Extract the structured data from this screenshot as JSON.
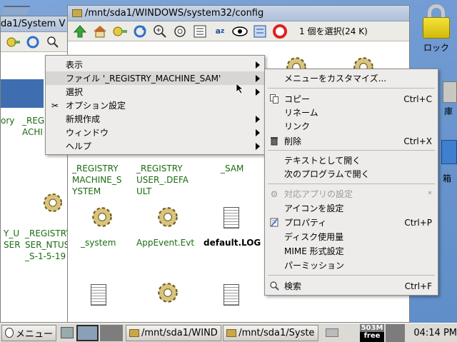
{
  "desktop": {
    "lock_label": "ロック",
    "right_labels": [
      "箱",
      "庫",
      "箱"
    ]
  },
  "back_window": {
    "title": "da1/System V",
    "left_labels": [
      "ory",
      "_REGI",
      "ACHI",
      "Y_U",
      "SER",
      "_REGISTRY",
      "SER_NTUS",
      "_S-1-5-19"
    ]
  },
  "main_window": {
    "title": "/mnt/sda1/WINDOWS/system32/config",
    "status": "1 個を選択(24 K)",
    "files": [
      {
        "line1": "_REGISTRY",
        "line2": "MACHINE_S",
        "line3": "YSTEM"
      },
      {
        "line1": "_REGISTRY",
        "line2": "USER_.DEFA",
        "line3": "ULT"
      },
      {
        "line1": "_SAM",
        "line2": "",
        "line3": ""
      },
      {
        "line1": "_system",
        "line2": "",
        "line3": ""
      },
      {
        "line1": "AppEvent.Evt",
        "line2": "",
        "line3": ""
      },
      {
        "line1": "default.LOG",
        "line2": "",
        "line3": ""
      }
    ]
  },
  "menu": {
    "items": [
      "表示",
      "ファイル '_REGISTRY_MACHINE_SAM'",
      "選択",
      "オプション設定",
      "新規作成",
      "ウィンドウ",
      "ヘルプ"
    ]
  },
  "submenu": {
    "items": [
      {
        "label": "メニューをカスタマイズ...",
        "shortcut": ""
      },
      {
        "label": "コピー",
        "shortcut": "Ctrl+C"
      },
      {
        "label": "リネーム",
        "shortcut": ""
      },
      {
        "label": "リンク",
        "shortcut": ""
      },
      {
        "label": "削除",
        "shortcut": "Ctrl+X"
      },
      {
        "label": "テキストとして開く",
        "shortcut": ""
      },
      {
        "label": "次のプログラムで開く",
        "shortcut": ""
      },
      {
        "label": "対応アプリの設定",
        "shortcut": "*"
      },
      {
        "label": "アイコンを設定",
        "shortcut": ""
      },
      {
        "label": "プロパティ",
        "shortcut": "Ctrl+P"
      },
      {
        "label": "ディスク使用量",
        "shortcut": ""
      },
      {
        "label": "MIME 形式設定",
        "shortcut": ""
      },
      {
        "label": "パーミッション",
        "shortcut": ""
      },
      {
        "label": "検索",
        "shortcut": "Ctrl+F"
      }
    ]
  },
  "taskbar": {
    "menu_label": "メニュー",
    "task1": "/mnt/sda1/WIND",
    "task2": "/mnt/sda1/Syste",
    "mem_top": "503M",
    "mem_bottom": "free",
    "clock": "04:14 PM"
  }
}
